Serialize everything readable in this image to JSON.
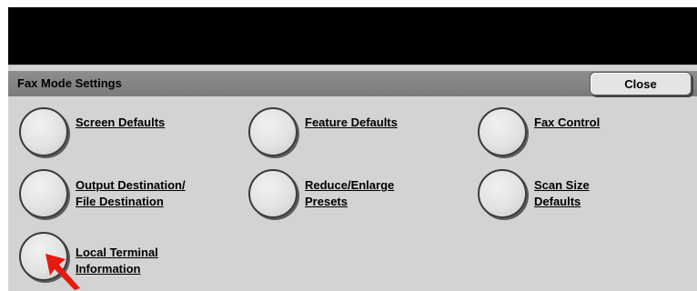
{
  "header": {
    "title": "Fax Mode Settings",
    "close_label": "Close"
  },
  "items": [
    {
      "line1": "Screen Defaults",
      "line2": ""
    },
    {
      "line1": "Feature Defaults",
      "line2": ""
    },
    {
      "line1": "Fax Control",
      "line2": ""
    },
    {
      "line1": "Output Destination/",
      "line2": "File Destination"
    },
    {
      "line1": "Reduce/Enlarge",
      "line2": "Presets"
    },
    {
      "line1": "Scan Size",
      "line2": "Defaults"
    },
    {
      "line1": "Local Terminal",
      "line2": "Information"
    }
  ],
  "colors": {
    "topbar": "#000000",
    "panel": "#d3d3d3",
    "header": "#858585",
    "pointer": "#e8190f"
  },
  "icons": {
    "pointer": "red-arrow-pointer-icon"
  }
}
